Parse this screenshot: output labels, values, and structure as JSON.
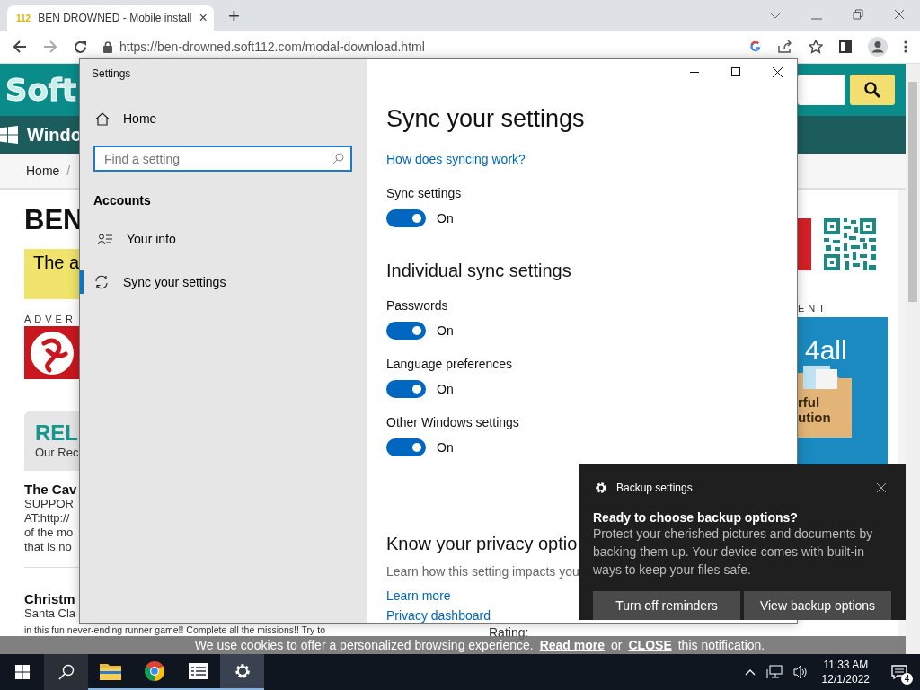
{
  "browser": {
    "tab": {
      "favicon": "112",
      "title": "BEN DROWNED - Mobile install",
      "close": "×"
    },
    "new_tab": "+",
    "url": "https://ben-drowned.soft112.com/modal-download.html"
  },
  "page": {
    "logo": "Soft",
    "nav": "Windo",
    "breadcrumb": [
      "Home",
      "/"
    ],
    "title": "BEN",
    "notice": "The a",
    "ad_label_left": "ADVER",
    "related": {
      "title": "REL",
      "subtitle": "Our Rec"
    },
    "articles": [
      {
        "title": "The Cav",
        "lines": [
          "SUPPOR",
          "AT:http://",
          "of the mo",
          "that is no"
        ]
      },
      {
        "title": "Christm",
        "lines": [
          "Santa Cla",
          "in this fun never-ending runner game!! Complete all the missions!! Try to"
        ]
      }
    ],
    "rating": "Rating:",
    "ad_label_right": "ENT",
    "ad_right": {
      "brand": "4all",
      "lines": [
        "rful",
        "ution"
      ]
    }
  },
  "settings": {
    "title": "Settings",
    "home": "Home",
    "search": {
      "placeholder": "Find a setting"
    },
    "section": "Accounts",
    "nav": [
      {
        "kind": "info",
        "label": "Your info",
        "selected": false
      },
      {
        "kind": "sync",
        "label": "Sync your settings",
        "selected": true
      }
    ],
    "heading": "Sync your settings",
    "help_link": "How does syncing work?",
    "master": {
      "label": "Sync settings",
      "on": true,
      "state": "On"
    },
    "subheading": "Individual sync settings",
    "toggles": [
      {
        "label": "Passwords",
        "on": true,
        "state": "On"
      },
      {
        "label": "Language preferences",
        "on": true,
        "state": "On"
      },
      {
        "label": "Other Windows settings",
        "on": true,
        "state": "On"
      }
    ],
    "privacy": {
      "heading": "Know your privacy optio",
      "text": "Learn how this setting impacts you",
      "links": [
        "Learn more",
        "Privacy dashboard"
      ]
    }
  },
  "toast": {
    "app": "Backup settings",
    "heading": "Ready to choose backup options?",
    "body": "Protect your cherished pictures and documents by backing them up. Your device comes with built-in ways to keep your files safe.",
    "buttons": [
      "Turn off reminders",
      "View backup options"
    ]
  },
  "cookie_bar": {
    "text": "We use cookies to offer a personalized browsing experience.",
    "read_more": "Read more",
    "or": "or",
    "close": "CLOSE",
    "tail": "this notification."
  },
  "taskbar": {
    "apps": [
      {
        "kind": "search",
        "running": false,
        "selected": false
      },
      {
        "kind": "folder",
        "running": true,
        "selected": false
      },
      {
        "kind": "chrome",
        "running": true,
        "selected": false
      },
      {
        "kind": "notes",
        "running": true,
        "selected": false
      },
      {
        "kind": "gear",
        "running": true,
        "selected": true
      }
    ],
    "time": "11:33 AM",
    "date": "12/1/2022",
    "notifications": "4"
  }
}
